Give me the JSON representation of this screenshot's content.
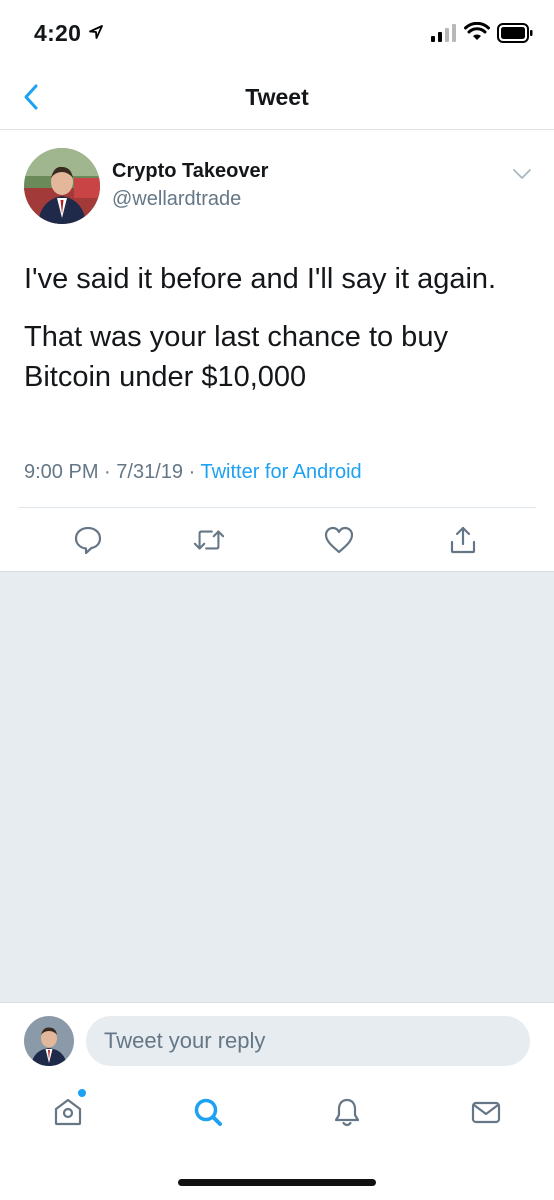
{
  "status_bar": {
    "time": "4:20"
  },
  "nav": {
    "title": "Tweet"
  },
  "tweet": {
    "author_name": "Crypto Takeover",
    "author_handle": "@wellardtrade",
    "text_lines": [
      "I've said it before and I'll say it again.",
      "That was your last chance to buy Bitcoin under $10,000"
    ],
    "time": "9:00 PM",
    "date": "7/31/19",
    "separator": "·",
    "source": "Twitter for Android"
  },
  "reply": {
    "placeholder": "Tweet your reply"
  },
  "colors": {
    "accent": "#1da1f2",
    "icon_gray": "#657786",
    "background_gray": "#e6ecf0"
  },
  "icons": {
    "back": "chevron-left-icon",
    "caret": "chevron-down-icon",
    "reply": "speech-bubble-icon",
    "retweet": "retweet-icon",
    "like": "heart-icon",
    "share": "share-icon",
    "home": "home-icon",
    "search": "search-icon",
    "notifications": "bell-icon",
    "messages": "envelope-icon"
  }
}
